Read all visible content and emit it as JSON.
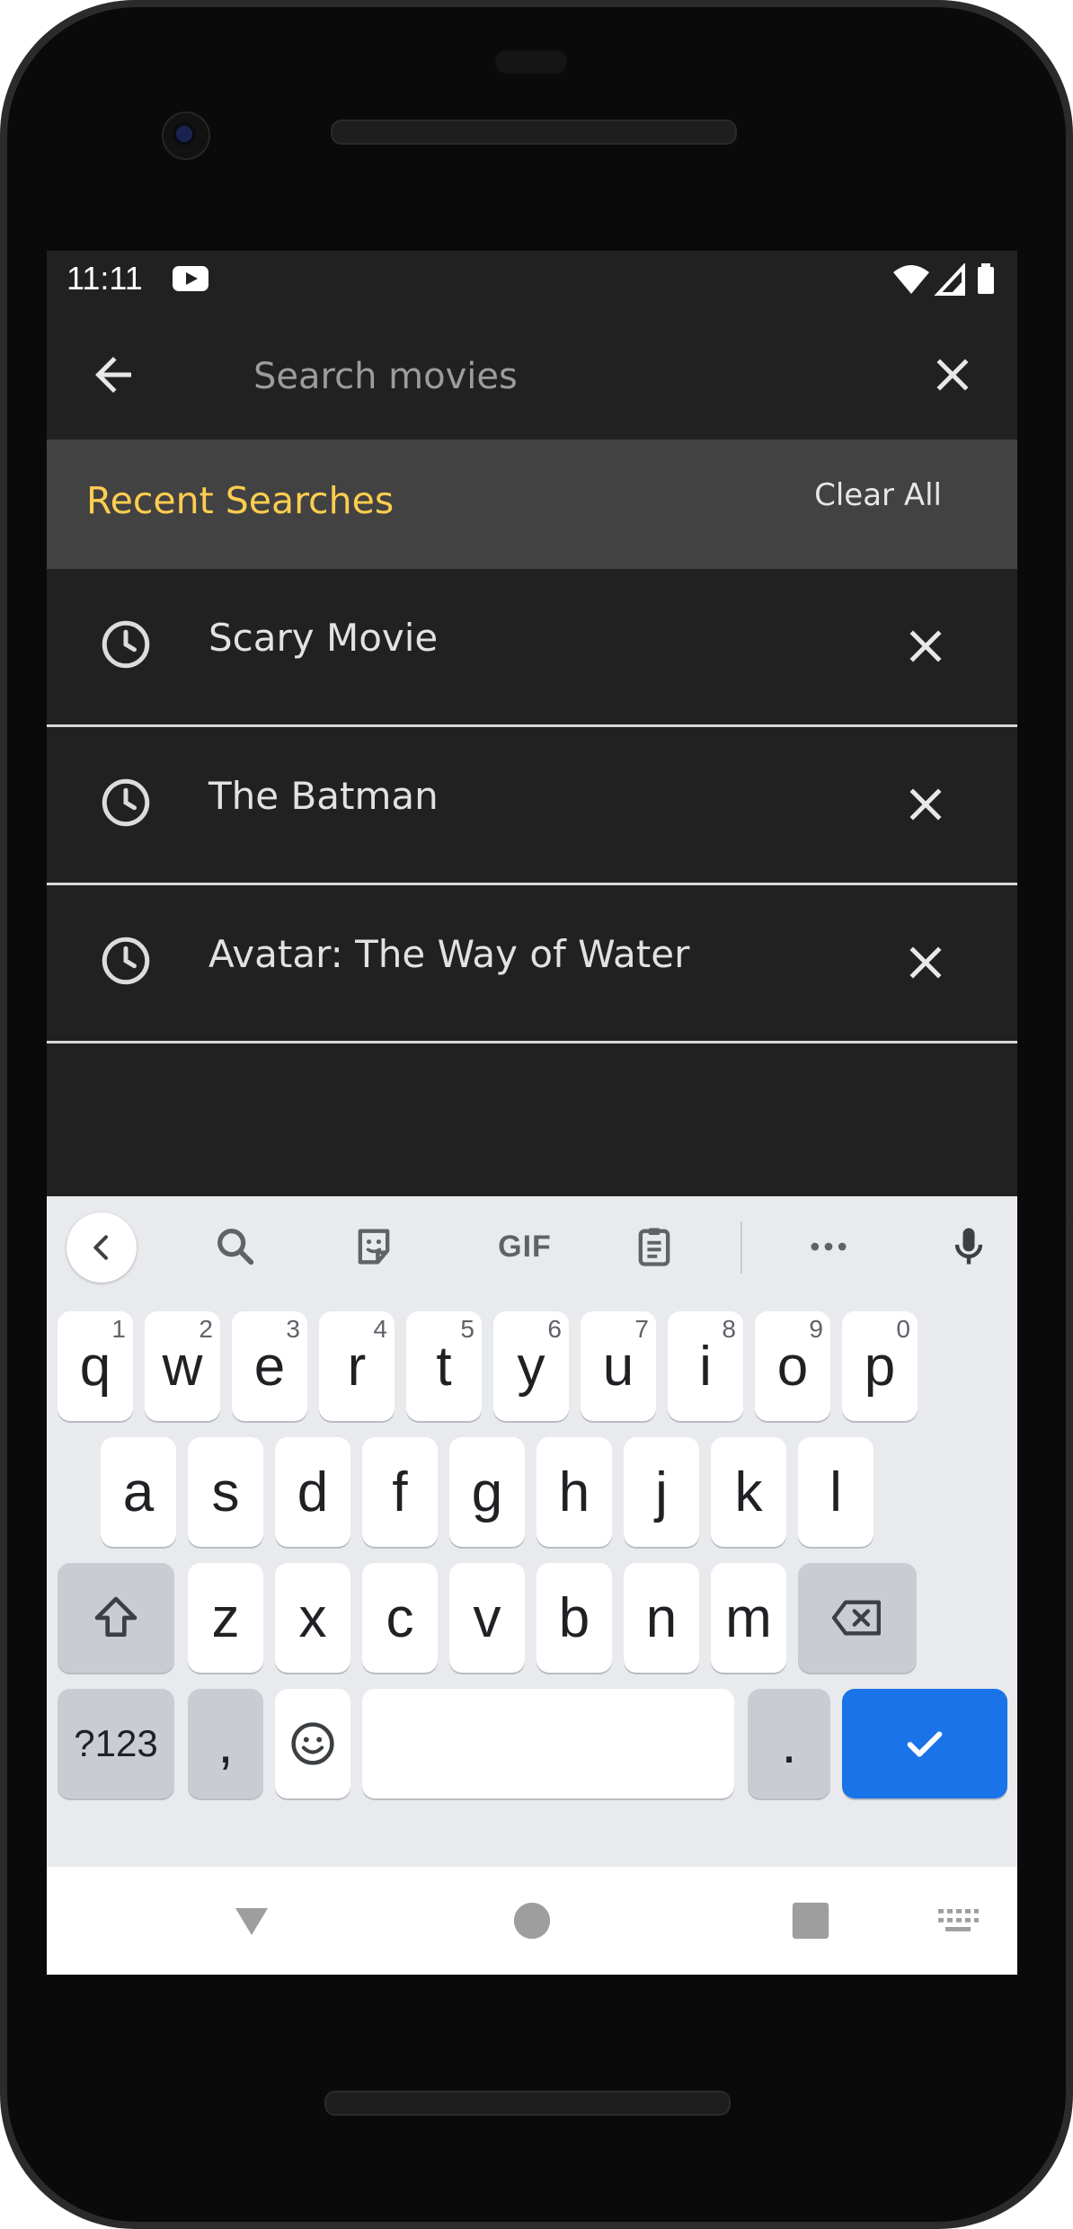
{
  "status_bar": {
    "time": "11:11",
    "icons": [
      "youtube-icon",
      "wifi-icon",
      "signal-icon",
      "battery-icon"
    ]
  },
  "search": {
    "placeholder": "Search movies",
    "value": ""
  },
  "recent": {
    "title": "Recent Searches",
    "clear_all_label": "Clear All",
    "items": [
      {
        "label": "Scary Movie"
      },
      {
        "label": "The Batman"
      },
      {
        "label": "Avatar: The Way of Water"
      }
    ]
  },
  "keyboard": {
    "toolbar": [
      "chevron-left-icon",
      "search-icon",
      "sticker-icon",
      "GIF",
      "clipboard-icon",
      "more-icon",
      "mic-icon"
    ],
    "gif_label": "GIF",
    "row1": [
      {
        "key": "q",
        "hint": "1"
      },
      {
        "key": "w",
        "hint": "2"
      },
      {
        "key": "e",
        "hint": "3"
      },
      {
        "key": "r",
        "hint": "4"
      },
      {
        "key": "t",
        "hint": "5"
      },
      {
        "key": "y",
        "hint": "6"
      },
      {
        "key": "u",
        "hint": "7"
      },
      {
        "key": "i",
        "hint": "8"
      },
      {
        "key": "o",
        "hint": "9"
      },
      {
        "key": "p",
        "hint": "0"
      }
    ],
    "row2": [
      "a",
      "s",
      "d",
      "f",
      "g",
      "h",
      "j",
      "k",
      "l"
    ],
    "row3": [
      "z",
      "x",
      "c",
      "v",
      "b",
      "n",
      "m"
    ],
    "row4": {
      "symbols": "?123",
      "comma": ",",
      "period": "."
    }
  },
  "colors": {
    "accent": "#ffcd4f",
    "background": "#212121",
    "header_bg": "#424242",
    "keyboard_action": "#1a73e8"
  }
}
